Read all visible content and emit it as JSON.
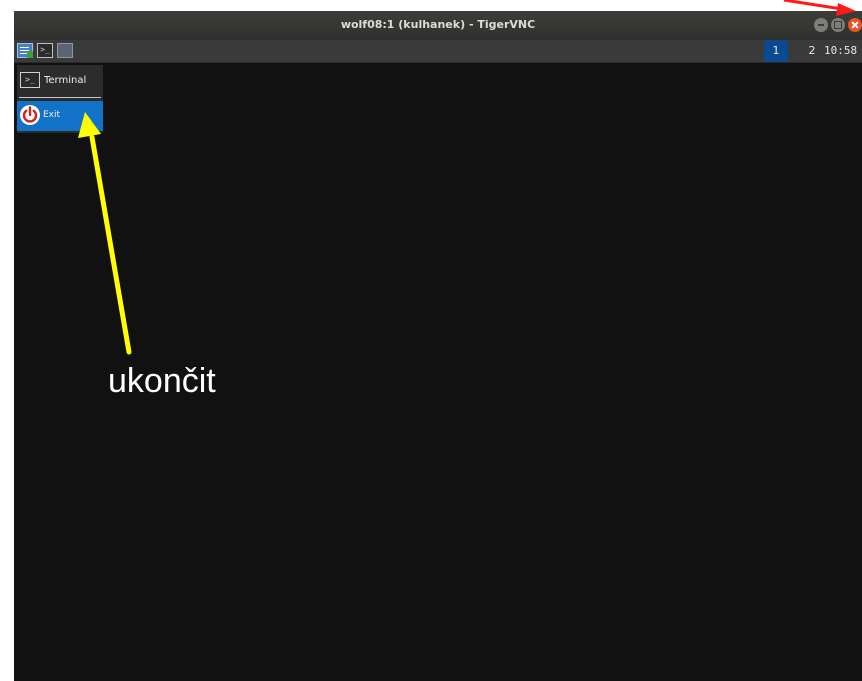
{
  "window": {
    "title": "wolf08:1 (kulhanek) - TigerVNC",
    "controls": {
      "minimize_icon": "minimize-icon",
      "maximize_icon": "maximize-icon",
      "close_icon": "close-icon"
    }
  },
  "panel": {
    "launcher_icons": [
      "app-menu-icon",
      "terminal-icon",
      "show-desktop-icon"
    ],
    "workspaces": [
      {
        "label": "1",
        "active": true
      },
      {
        "label": "2",
        "active": false
      }
    ],
    "clock": "10:58"
  },
  "menu": {
    "items": [
      {
        "label": "Terminal",
        "icon": "terminal-icon"
      },
      {
        "label": "Exit",
        "icon": "power-icon",
        "highlighted": true
      }
    ],
    "terminal_glyph": ">_"
  },
  "annotation": {
    "label": "ukončit",
    "colors": {
      "label_arrow": "#ffff00",
      "close_arrow": "#ff0000"
    }
  },
  "colors": {
    "desktop": "#111111",
    "highlight": "#1272c7",
    "active_workspace": "#0b4a8e",
    "close_button": "#e95420"
  }
}
